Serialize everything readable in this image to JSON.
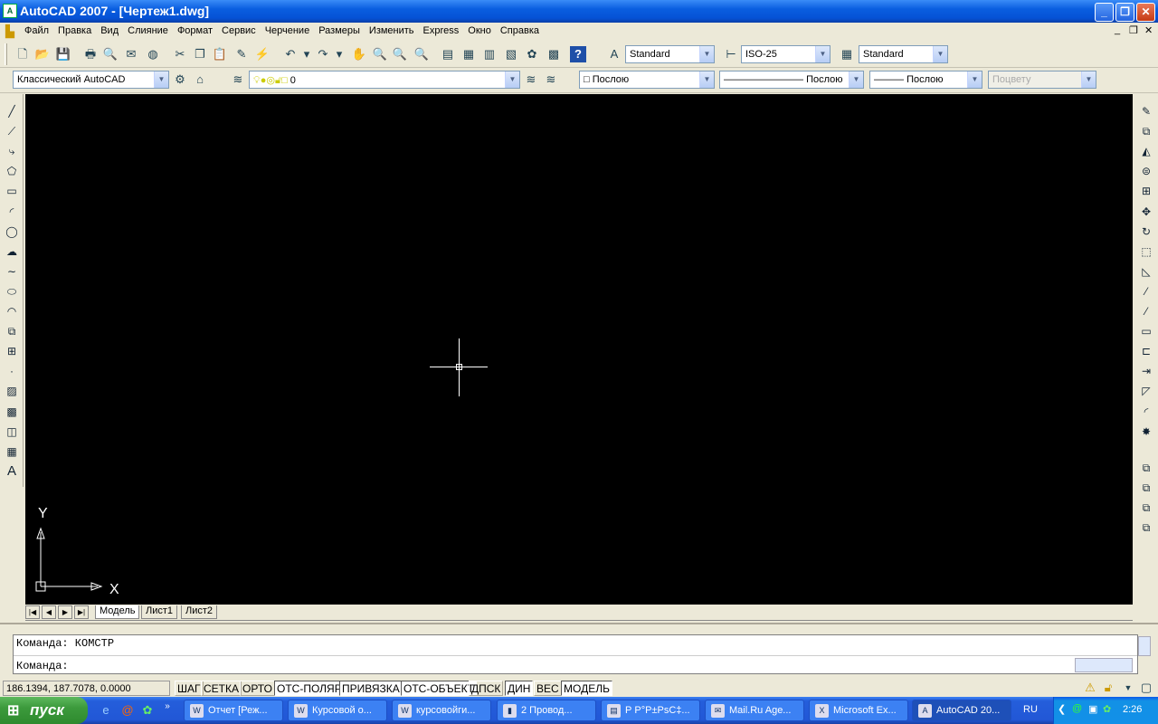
{
  "window": {
    "title": "AutoCAD 2007 - [Чертеж1.dwg]",
    "app_icon": "autocad-icon"
  },
  "menu": [
    "Файл",
    "Правка",
    "Вид",
    "Слияние",
    "Формат",
    "Сервис",
    "Черчение",
    "Размеры",
    "Изменить",
    "Express",
    "Окно",
    "Справка"
  ],
  "toolbar": {
    "text_style": "Standard",
    "dim_style": "ISO-25",
    "table_style": "Standard",
    "workspace": "Классический AutoCAD",
    "layer": "0",
    "color": "Послою",
    "linetype": "Послою",
    "lineweight": "Послою",
    "plot_style": "Поцвету"
  },
  "drawing": {
    "ucs_x": "X",
    "ucs_y": "Y",
    "background": "#000000"
  },
  "tabs": [
    "Модель",
    "Лист1",
    "Лист2"
  ],
  "command": {
    "history": "Команда: КОМСТР",
    "prompt": "Команда:"
  },
  "status": {
    "coords": "186.1394, 187.7078, 0.0000",
    "buttons": [
      {
        "label": "ШАГ",
        "on": false
      },
      {
        "label": "СЕТКА",
        "on": false
      },
      {
        "label": "ОРТО",
        "on": false
      },
      {
        "label": "ОТС-ПОЛЯР",
        "on": true
      },
      {
        "label": "ПРИВЯЗКА",
        "on": true
      },
      {
        "label": "ОТС-ОБЪЕКТ",
        "on": true
      },
      {
        "label": "ДПСК",
        "on": false
      },
      {
        "label": "ДИН",
        "on": true
      },
      {
        "label": "ВЕС",
        "on": false
      },
      {
        "label": "МОДЕЛЬ",
        "on": true
      }
    ]
  },
  "taskbar": {
    "start": "пуск",
    "tasks": [
      "Отчет [Реж...",
      "Курсовой о...",
      "курсовойги...",
      "2 Провод...",
      "Р Р°Р±РѕС‡...",
      "Mail.Ru Age...",
      "Microsoft Ex...",
      "AutoCAD 20..."
    ],
    "lang": "RU",
    "clock": "2:26"
  }
}
